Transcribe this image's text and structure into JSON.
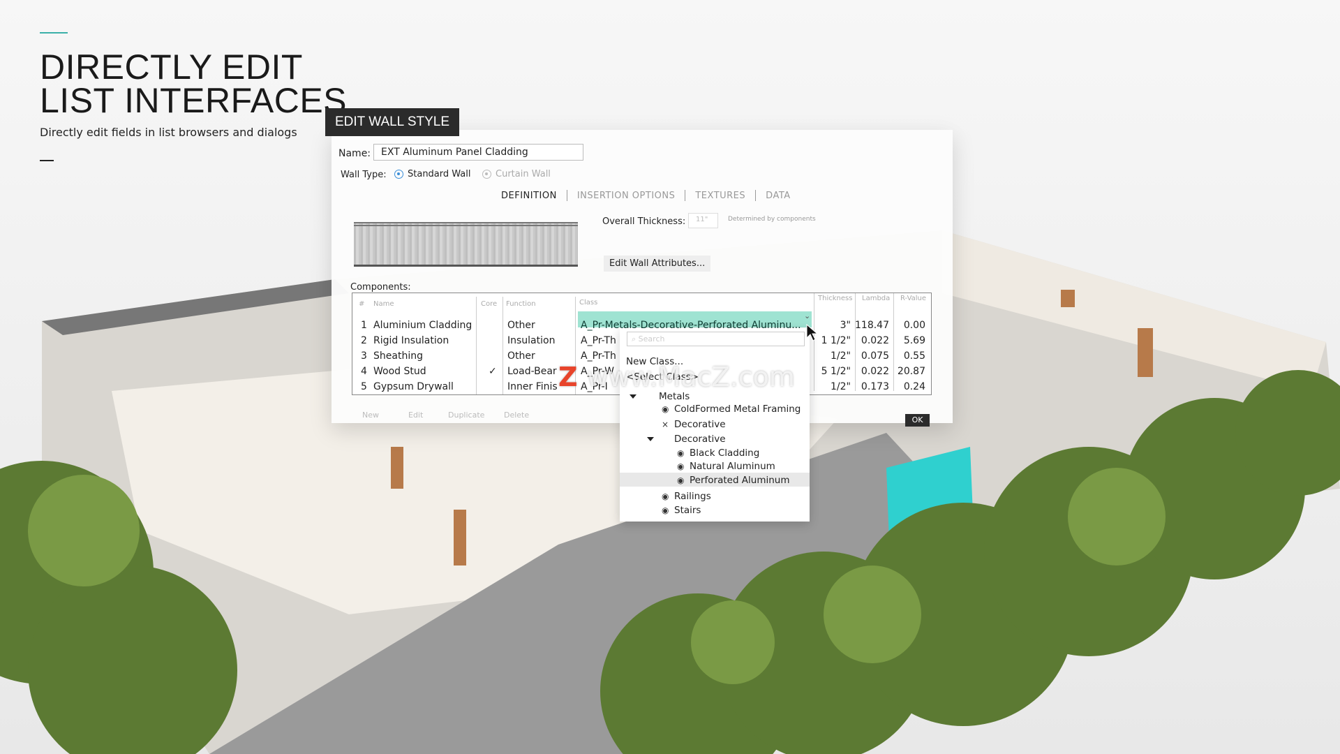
{
  "hero": {
    "title_line1": "DIRECTLY EDIT",
    "title_line2": "LIST INTERFACES",
    "subtitle": "Directly edit fields in list browsers and dialogs"
  },
  "dialog": {
    "title": "EDIT WALL STYLE",
    "name_label": "Name:",
    "name_value": "EXT Aluminum Panel Cladding",
    "wall_type_label": "Wall Type:",
    "wall_types": [
      {
        "label": "Standard Wall",
        "selected": true
      },
      {
        "label": "Curtain Wall",
        "selected": false
      }
    ],
    "tabs": [
      {
        "label": "DEFINITION",
        "active": true
      },
      {
        "label": "INSERTION OPTIONS"
      },
      {
        "label": "TEXTURES"
      },
      {
        "label": "DATA"
      }
    ],
    "overall_thickness_label": "Overall Thickness:",
    "overall_thickness_value": "11\"",
    "determined_note": "Determined by components",
    "edit_attributes_button": "Edit Wall Attributes...",
    "components_label": "Components:",
    "columns": [
      "#",
      "Name",
      "Core",
      "Function",
      "Class",
      "Thickness",
      "Lambda",
      "R-Value"
    ],
    "rows": [
      {
        "n": "1",
        "name": "Aluminium Cladding",
        "core": "",
        "function": "Other",
        "class": "A_Pr-Metals-Decorative-Perforated Aluminu...",
        "thickness": "3\"",
        "lambda": "118.47",
        "rvalue": "0.00"
      },
      {
        "n": "2",
        "name": "Rigid Insulation",
        "core": "",
        "function": "Insulation",
        "class": "A_Pr-Th",
        "thickness": "1 1/2\"",
        "lambda": "0.022",
        "rvalue": "5.69"
      },
      {
        "n": "3",
        "name": "Sheathing",
        "core": "",
        "function": "Other",
        "class": "A_Pr-Th",
        "thickness": "1/2\"",
        "lambda": "0.075",
        "rvalue": "0.55"
      },
      {
        "n": "4",
        "name": "Wood Stud",
        "core": "✓",
        "function": "Load-Bear",
        "class": "A_Pr-W",
        "thickness": "5 1/2\"",
        "lambda": "0.022",
        "rvalue": "20.87"
      },
      {
        "n": "5",
        "name": "Gypsum Drywall",
        "core": "",
        "function": "Inner Finis",
        "class": "A_Pr-I",
        "thickness": "1/2\"",
        "lambda": "0.173",
        "rvalue": "0.24"
      }
    ],
    "footer_buttons": [
      "New",
      "Edit",
      "Duplicate",
      "Delete"
    ],
    "ok_button": "OK",
    "highlight_color": "#9fe3d2"
  },
  "class_dropdown": {
    "search_placeholder": "Search",
    "new_class": "New Class...",
    "select_class": "<Select Class>",
    "tree": [
      {
        "label": "Metals",
        "type": "group"
      },
      {
        "label": "ColdFormed Metal Framing",
        "icon": "eye-icon"
      },
      {
        "label": "Decorative",
        "icon": "close-icon"
      },
      {
        "label": "Decorative",
        "type": "group"
      },
      {
        "label": "Black Cladding",
        "icon": "eye-icon"
      },
      {
        "label": "Natural Aluminum",
        "icon": "eye-icon"
      },
      {
        "label": "Perforated Aluminum",
        "icon": "eye-icon",
        "selected": true
      },
      {
        "label": "Railings",
        "icon": "eye-icon"
      },
      {
        "label": "Stairs",
        "icon": "eye-icon"
      }
    ]
  },
  "watermark": "www.MacZ.com"
}
